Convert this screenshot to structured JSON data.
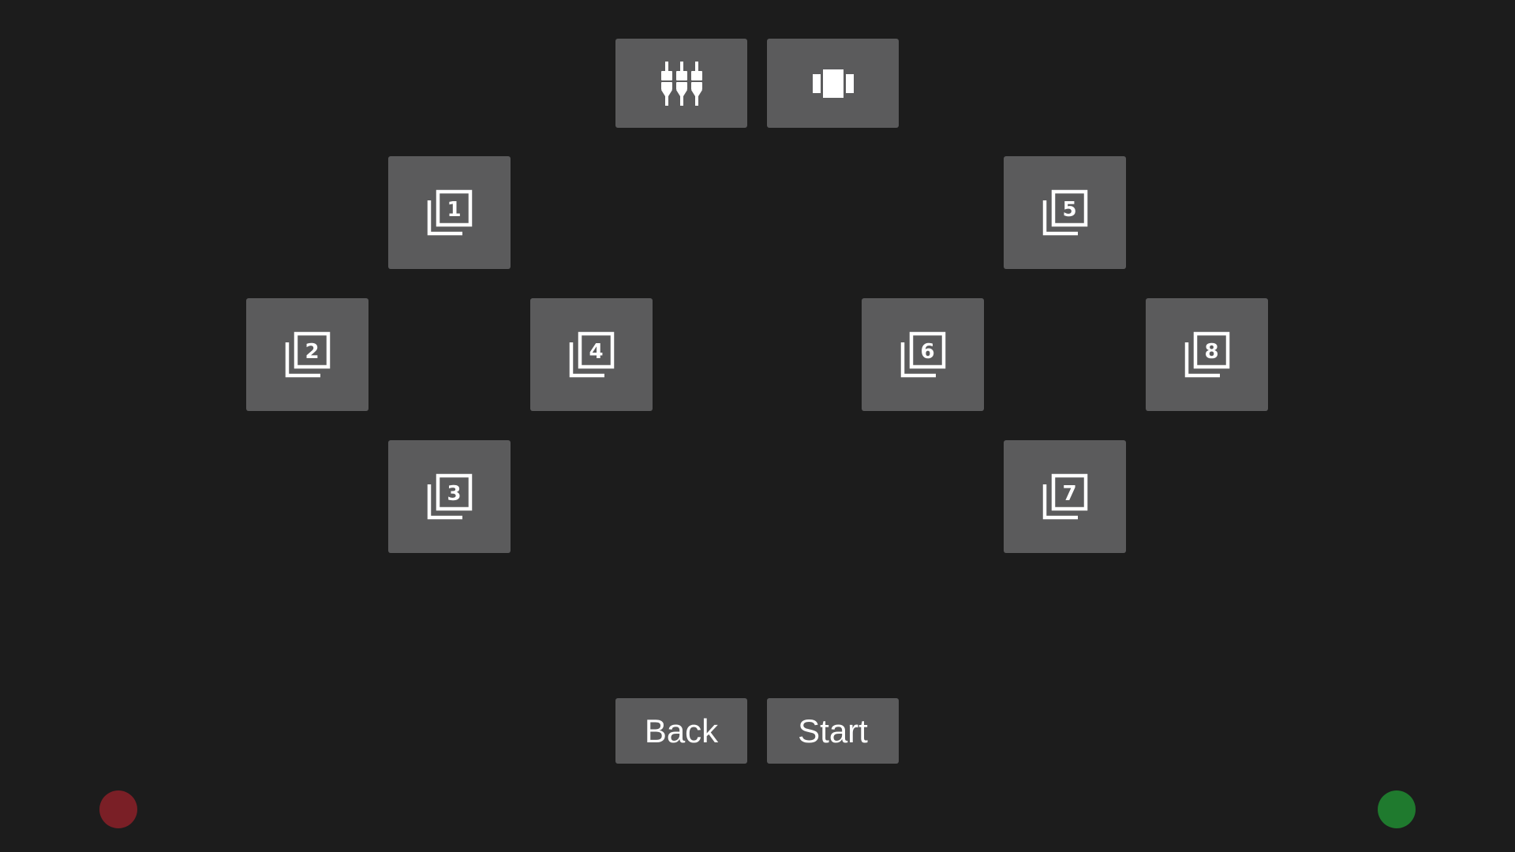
{
  "toolbar": {
    "mixer_icon": "equalizer-sliders-icon",
    "carousel_icon": "view-carousel-icon"
  },
  "pads": [
    {
      "number": "1",
      "icon": "filter-1-icon"
    },
    {
      "number": "2",
      "icon": "filter-2-icon"
    },
    {
      "number": "3",
      "icon": "filter-3-icon"
    },
    {
      "number": "4",
      "icon": "filter-4-icon"
    },
    {
      "number": "5",
      "icon": "filter-5-icon"
    },
    {
      "number": "6",
      "icon": "filter-6-icon"
    },
    {
      "number": "7",
      "icon": "filter-7-icon"
    },
    {
      "number": "8",
      "icon": "filter-8-icon"
    }
  ],
  "controls": {
    "back_label": "Back",
    "start_label": "Start"
  },
  "indicators": {
    "left_color": "#7a1f26",
    "right_color": "#1f7a2e"
  },
  "colors": {
    "background": "#1c1c1c",
    "button": "#5b5b5c",
    "icon": "#ffffff"
  }
}
